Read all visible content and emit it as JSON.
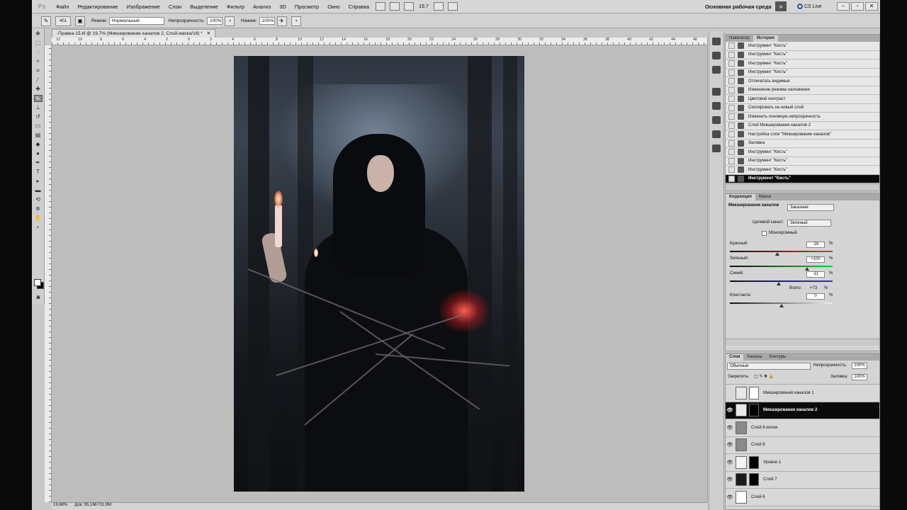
{
  "menubar": {
    "logo": "Ps",
    "items": [
      "Файл",
      "Редактирование",
      "Изображение",
      "Слои",
      "Выделение",
      "Фильтр",
      "Анализ",
      "3D",
      "Просмотр",
      "Окно",
      "Справка"
    ],
    "zoom": "19,7",
    "workspace": "Основная рабочая среда",
    "cs_live": "CS Live"
  },
  "options": {
    "brush_size": "401",
    "mode_label": "Режим:",
    "mode_value": "Нормальный",
    "opacity_label": "Непрозрачность:",
    "opacity_value": "100%",
    "flow_label": "Нажим:",
    "flow_value": "100%"
  },
  "document": {
    "tab_title": "-Правка-15.tif @ 19,7% (Микширование каналов 2, Слой-маска/16) *",
    "zoom_status": "19,68%",
    "doc_status": "Док: 95,1M/731,9M",
    "ruler_numbers": [
      "12",
      "10",
      "8",
      "6",
      "4",
      "2",
      "0",
      "2",
      "4",
      "6",
      "8",
      "10",
      "12",
      "14",
      "16",
      "18",
      "20",
      "22",
      "24",
      "26",
      "28",
      "30",
      "32",
      "34",
      "36",
      "38",
      "40",
      "42",
      "44",
      "46"
    ]
  },
  "history": {
    "tabs": [
      "Навигатор",
      "История"
    ],
    "active_tab": 1,
    "items": [
      "Инструмент \"Кисть\"",
      "Инструмент \"Кисть\"",
      "Инструмент \"Кисть\"",
      "Инструмент \"Кисть\"",
      "Отпечатать видимые",
      "Изменение режима наложения",
      "Цветовой контраст",
      "Скопировать на новый слой",
      "Изменить основную непрозрачность",
      "Слой Микширование каналов 2",
      "Настройка слоя \"Микширование каналов\"",
      "Заливка",
      "Инструмент \"Кисть\"",
      "Инструмент \"Кисть\"",
      "Инструмент \"Кисть\"",
      "Инструмент \"Кисть\""
    ],
    "selected_index": 15
  },
  "adjustments": {
    "tabs": [
      "Коррекция",
      "Маски"
    ],
    "title": "Микширование каналов",
    "preset_value": "Заказная",
    "target_label": "Целевой канал:",
    "target_value": "Зеленый",
    "mono_label": "Монохромный",
    "red_label": "Красный:",
    "red_value": "-16",
    "green_label": "Зеленый:",
    "green_value": "+100",
    "blue_label": "Синий:",
    "blue_value": "-11",
    "total_label": "Всего:",
    "total_value": "+73",
    "const_label": "Константа:",
    "const_value": "0",
    "pct": "%"
  },
  "layers": {
    "tabs": [
      "Слои",
      "Каналы",
      "Контуры"
    ],
    "blend_mode": "Обычные",
    "opacity_label": "Непрозрачность:",
    "opacity_value": "100%",
    "lock_label": "Закрепить:",
    "fill_label": "Заливка:",
    "fill_value": "100%",
    "items": [
      {
        "name": "Микширования каналов 1",
        "visible": false,
        "selected": false
      },
      {
        "name": "Микширование каналов 2",
        "visible": true,
        "selected": true
      },
      {
        "name": "Слой 8 копия",
        "visible": true,
        "selected": false
      },
      {
        "name": "Слой 8",
        "visible": true,
        "selected": false
      },
      {
        "name": "Уровни 1",
        "visible": true,
        "selected": false
      },
      {
        "name": "Слой 7",
        "visible": true,
        "selected": false
      },
      {
        "name": "Слой 6",
        "visible": true,
        "selected": false
      }
    ]
  },
  "colors": {
    "accent_selected": "#0a0a0a",
    "panel_bg": "#d4d4d4",
    "workspace_bg": "#bdbdbd"
  }
}
